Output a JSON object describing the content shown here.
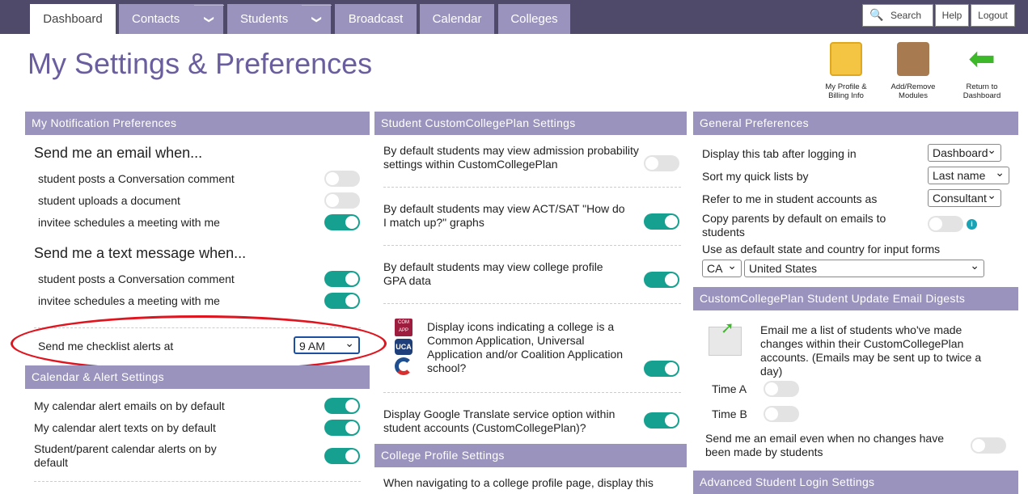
{
  "nav": {
    "tabs": [
      "Dashboard",
      "Contacts",
      "Students",
      "Broadcast",
      "Calendar",
      "Colleges"
    ],
    "search": "Search",
    "help": "Help",
    "logout": "Logout"
  },
  "page_title": "My Settings & Preferences",
  "quick_links": [
    "My Profile & Billing Info",
    "Add/Remove Modules",
    "Return to Dashboard"
  ],
  "notifications": {
    "header": "My Notification Preferences",
    "email_heading": "Send me an email when...",
    "email_items": [
      {
        "label": "student posts a Conversation comment",
        "on": false
      },
      {
        "label": "student uploads a document",
        "on": false
      },
      {
        "label": "invitee schedules a meeting with me",
        "on": true
      }
    ],
    "text_heading": "Send me a text message when...",
    "text_items": [
      {
        "label": "student posts a Conversation comment",
        "on": true
      },
      {
        "label": "invitee schedules a meeting with me",
        "on": true
      }
    ],
    "checklist_label": "Send me checklist alerts at",
    "checklist_value": "9 AM"
  },
  "calendar": {
    "header": "Calendar & Alert Settings",
    "items": [
      {
        "label": "My calendar alert emails on by default",
        "on": true
      },
      {
        "label": "My calendar alert texts on by default",
        "on": true
      },
      {
        "label": "Student/parent calendar alerts on by default",
        "on": true
      }
    ]
  },
  "student_ccp": {
    "header": "Student CustomCollegePlan Settings",
    "items": [
      {
        "label": "By default students may view admission probability settings within CustomCollegePlan",
        "on": false
      },
      {
        "label": "By default students may view ACT/SAT \"How do I match up?\" graphs",
        "on": true
      },
      {
        "label": "By default students may view college profile GPA data",
        "on": true
      },
      {
        "label": "Display icons indicating a college is a Common Application, Universal Application and/or Coalition Application school?",
        "on": true
      },
      {
        "label": "Display Google Translate service option within student accounts (CustomCollegePlan)?",
        "on": true
      }
    ],
    "icon_labels": [
      "COM APP",
      "UCA"
    ]
  },
  "college_profile": {
    "header": "College Profile Settings",
    "text": "When navigating to a college profile page, display this"
  },
  "general": {
    "header": "General Preferences",
    "tab_label": "Display this tab after logging in",
    "tab_value": "Dashboard",
    "sort_label": "Sort my quick lists by",
    "sort_value": "Last name",
    "refer_label": "Refer to me in student accounts as",
    "refer_value": "Consultant",
    "copy_label": "Copy parents by default on emails to students",
    "copy_on": false,
    "state_label": "Use as default state and country for input forms",
    "state_value": "CA",
    "country_value": "United States"
  },
  "digest": {
    "header": "CustomCollegePlan Student Update Email Digests",
    "text": "Email me a list of students who've made changes within their CustomCollegePlan accounts. (Emails may be sent up to twice a day)",
    "time_a": "Time A",
    "time_b": "Time B",
    "no_changes_label": "Send me an email even when no changes have been made by students"
  },
  "advanced": {
    "header": "Advanced Student Login Settings"
  },
  "colors": {
    "topbar": "#4f4a6a",
    "tab": "#9a93bd",
    "toggle_on": "#16a08f",
    "title": "#6b5e9e",
    "highlight": "#e0141e"
  }
}
